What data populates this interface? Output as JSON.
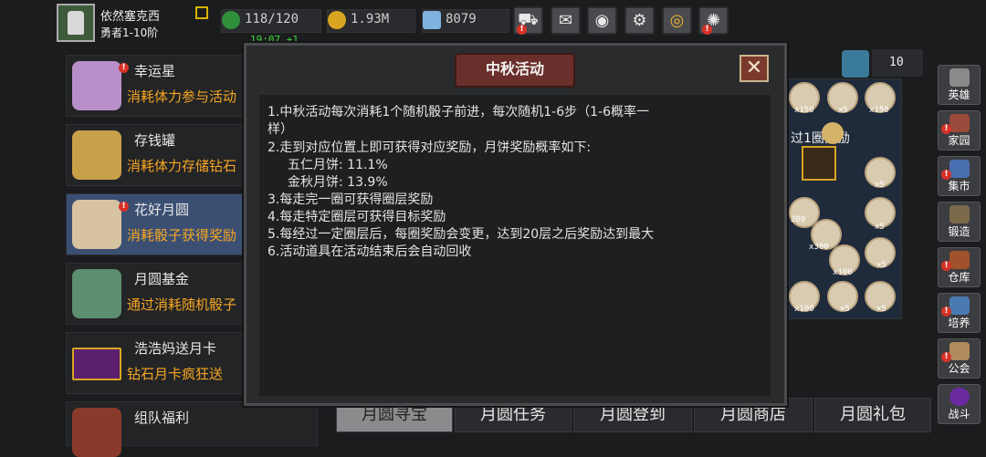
{
  "player": {
    "name": "依然塞克西",
    "rank": "勇者1-10阶"
  },
  "resources": {
    "stamina": "118/120",
    "gold": "1.93M",
    "gems": "8079",
    "regen_timer": "19:07 +1"
  },
  "top_buttons": [
    "shop-icon",
    "mail-icon",
    "gamepad-icon",
    "settings-icon",
    "lens-icon",
    "fireworks-icon"
  ],
  "events": [
    {
      "title": "幸运星",
      "subtitle": "消耗体力参与活动",
      "alert": true
    },
    {
      "title": "存钱罐",
      "subtitle": "消耗体力存储钻石",
      "alert": false
    },
    {
      "title": "花好月圆",
      "subtitle": "消耗骰子获得奖励",
      "alert": true,
      "selected": true
    },
    {
      "title": "月圆基金",
      "subtitle": "通过消耗随机骰子",
      "alert": false
    },
    {
      "title": "浩浩妈送月卡",
      "subtitle": "钻石月卡疯狂送",
      "alert": false
    },
    {
      "title": "组队福利",
      "subtitle": "",
      "alert": false
    }
  ],
  "board": {
    "dice_count": "10",
    "lap_reward_label": "过1圈奖励",
    "tile_labels": [
      "x150",
      "x5",
      "x150",
      "x5",
      "200",
      "x300",
      "x5",
      "x100",
      "x5",
      "x100",
      "x5",
      "x5"
    ]
  },
  "sidebar": [
    {
      "label": "英雄",
      "alert": false
    },
    {
      "label": "家园",
      "alert": true
    },
    {
      "label": "集市",
      "alert": true
    },
    {
      "label": "锻造",
      "alert": false
    },
    {
      "label": "仓库",
      "alert": true
    },
    {
      "label": "培养",
      "alert": true
    },
    {
      "label": "公会",
      "alert": true
    },
    {
      "label": "战斗",
      "alert": false
    }
  ],
  "tabs": [
    "月圆寻宝",
    "月圆任务",
    "月圆登到",
    "月圆商店",
    "月圆礼包"
  ],
  "modal": {
    "title": "中秋活动",
    "close": "✕",
    "rules": [
      "1.中秋活动每次消耗1个随机骰子前进，每次随机1-6步（1-6概率一",
      "样）",
      "2.走到对应位置上即可获得对应奖励，月饼奖励概率如下:",
      "  五仁月饼: 11.1%",
      "  金秋月饼: 13.9%",
      "3.每走完一圈可获得圈层奖励",
      "4.每走特定圈层可获得目标奖励",
      "5.每经过一定圈层后，每圈奖励会变更，达到20层之后奖励达到最大",
      "6.活动道具在活动结束后会自动回收"
    ]
  },
  "colors": {
    "accent_orange": "#f5a623",
    "selected_row": "#3b4f73",
    "alert_red": "#d63228",
    "timer_green": "#3ddc3d"
  }
}
